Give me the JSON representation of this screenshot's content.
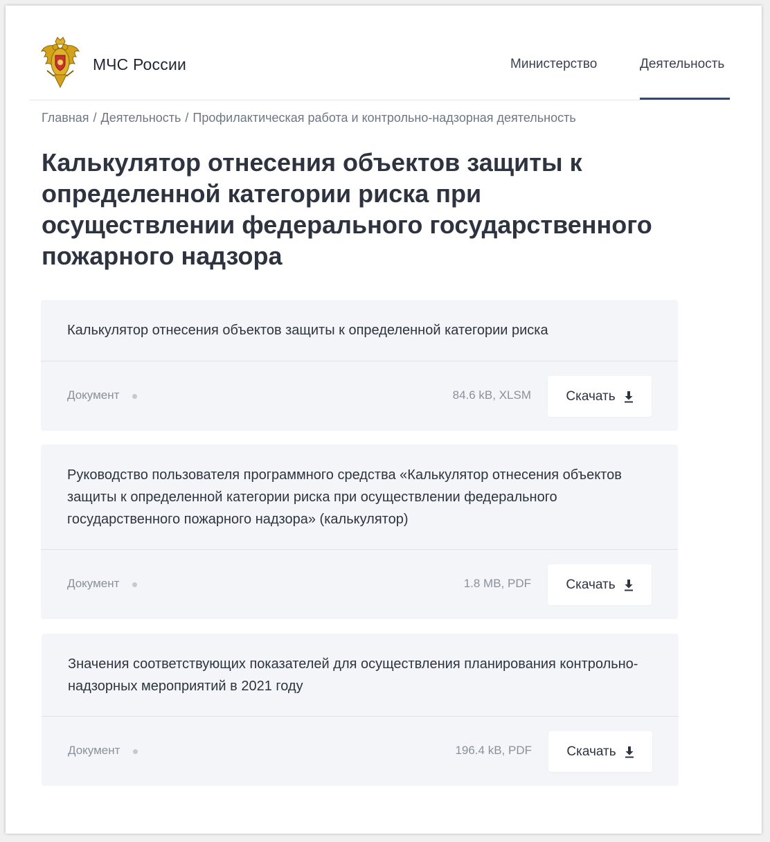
{
  "header": {
    "logo_text": "МЧС России",
    "nav": [
      {
        "label": "Министерство"
      },
      {
        "label": "Деятельность"
      }
    ]
  },
  "breadcrumb": {
    "items": [
      "Главная",
      "Деятельность",
      "Профилактическая работа и контрольно-надзорная деятельность"
    ],
    "separator": "/"
  },
  "page_title": "Калькулятор отнесения объектов защиты к определенной категории риска при осуществлении федерального государственного пожарного надзора",
  "documents": [
    {
      "title": "Калькулятор отнесения объектов защиты к определенной категории риска",
      "type": "Документ",
      "file_info": "84.6 kB, XLSM",
      "download_label": "Скачать"
    },
    {
      "title": "Руководство пользователя программного средства «Калькулятор отнесения объектов защиты к определенной категории риска при осуществлении федерального государственного пожарного надзора» (калькулятор)",
      "type": "Документ",
      "file_info": "1.8 MB, PDF",
      "download_label": "Скачать"
    },
    {
      "title": "Значения соответствующих показателей для осуществления планирования контрольно-надзорных мероприятий в 2021 году",
      "type": "Документ",
      "file_info": "196.4 kB, PDF",
      "download_label": "Скачать"
    }
  ],
  "colors": {
    "accent_underline": "#2d4a73",
    "card_background": "#f3f5f9",
    "title_text": "#2e3340",
    "muted_text": "#8a909b"
  },
  "icons": {
    "logo": "mchs-emblem-icon",
    "download": "download-arrow-icon"
  }
}
